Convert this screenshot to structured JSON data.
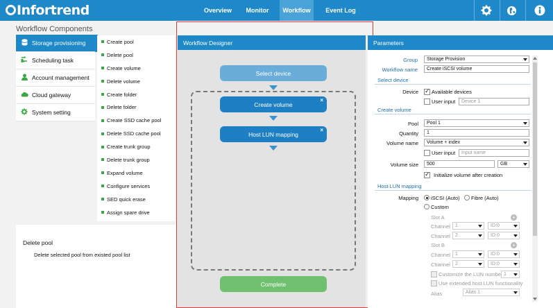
{
  "app": {
    "logo": "Infortrend",
    "nav": [
      "Overview",
      "Monitor",
      "Workflow",
      "Event Log"
    ],
    "active_nav": "Workflow",
    "icons": [
      "gear-icon",
      "globe-icon",
      "info-icon"
    ]
  },
  "left": {
    "title": "Workflow Components",
    "categories": [
      {
        "label": "Storage provisioning",
        "icon": "database-icon"
      },
      {
        "label": "Scheduling task",
        "icon": "scheduling-icon"
      },
      {
        "label": "Account management",
        "icon": "user-icon"
      },
      {
        "label": "Cloud gateway",
        "icon": "cloud-icon"
      },
      {
        "label": "System setting",
        "icon": "gear-icon"
      }
    ],
    "tasks": [
      "Create pool",
      "Delete pool",
      "Create volume",
      "Delete volume",
      "Create folder",
      "Delete folder",
      "Create SSD cache pool",
      "Delete SSD cache pool",
      "Create trunk group",
      "Delete trunk group",
      "Expand volume",
      "Configure services",
      "SED quick erase",
      "Assign spare drive"
    ],
    "description_title": "Delete pool",
    "description_text": "Delete selected pool from existed pool list"
  },
  "designer": {
    "title": "Workflow Designer",
    "select_device": "Select device",
    "create_volume": "Create volume",
    "host_lun_mapping": "Host LUN mapping",
    "close_symbol": "×",
    "complete": "Complete"
  },
  "params": {
    "title": "Parameters",
    "group_label": "Group",
    "group_value": "Storage Provision",
    "workflow_name_label": "Workflow name",
    "workflow_name_value": "Create iSCSI volume",
    "select_device_section": "Select device",
    "device_label": "Device",
    "available_devices": "Available devices",
    "user_input": "User input",
    "device_placeholder": "Device 1",
    "create_volume_section": "Create volume",
    "pool_label": "Pool",
    "pool_value": "Pool 1",
    "quantity_label": "Quantity",
    "quantity_value": "1",
    "volume_name_label": "Volume name",
    "volume_name_value": "Volume + index",
    "user_input_2": "User input",
    "input_name_placeholder": "Input name",
    "volume_size_label": "Volume size",
    "volume_size_value": "500",
    "volume_unit": "GB",
    "initialize_label": "Initialize volume after creation",
    "host_lun_section": "Host LUN mapping",
    "mapping_label": "Mapping",
    "iscsi_auto": "iSCSI (Auto)",
    "fibre_auto": "Fibre (Auto)",
    "custom": "Custom",
    "slot_a": "Slot A",
    "slot_b": "Slot B",
    "channel_label": "Channel",
    "channel_a1": "1",
    "id_a1": "ID:0",
    "channel_a2": "2",
    "id_a2": "ID:0",
    "channel_b1": "1",
    "id_b1": "ID:0",
    "channel_b2": "2",
    "id_b2": "ID:0",
    "customize_lun": "Customize the LUN number",
    "lun_value": "1",
    "extended_lun": "Use extended host LUN functionality",
    "alias_label": "Alias",
    "alias_value": "Alias 1",
    "plus_symbol": "+"
  },
  "colors": {
    "brand": "#1e88c8",
    "flow_button": "#1e7fc4",
    "flow_button_light": "#6aadda",
    "complete": "#6fc16f",
    "task_bullet": "#3aa845"
  }
}
